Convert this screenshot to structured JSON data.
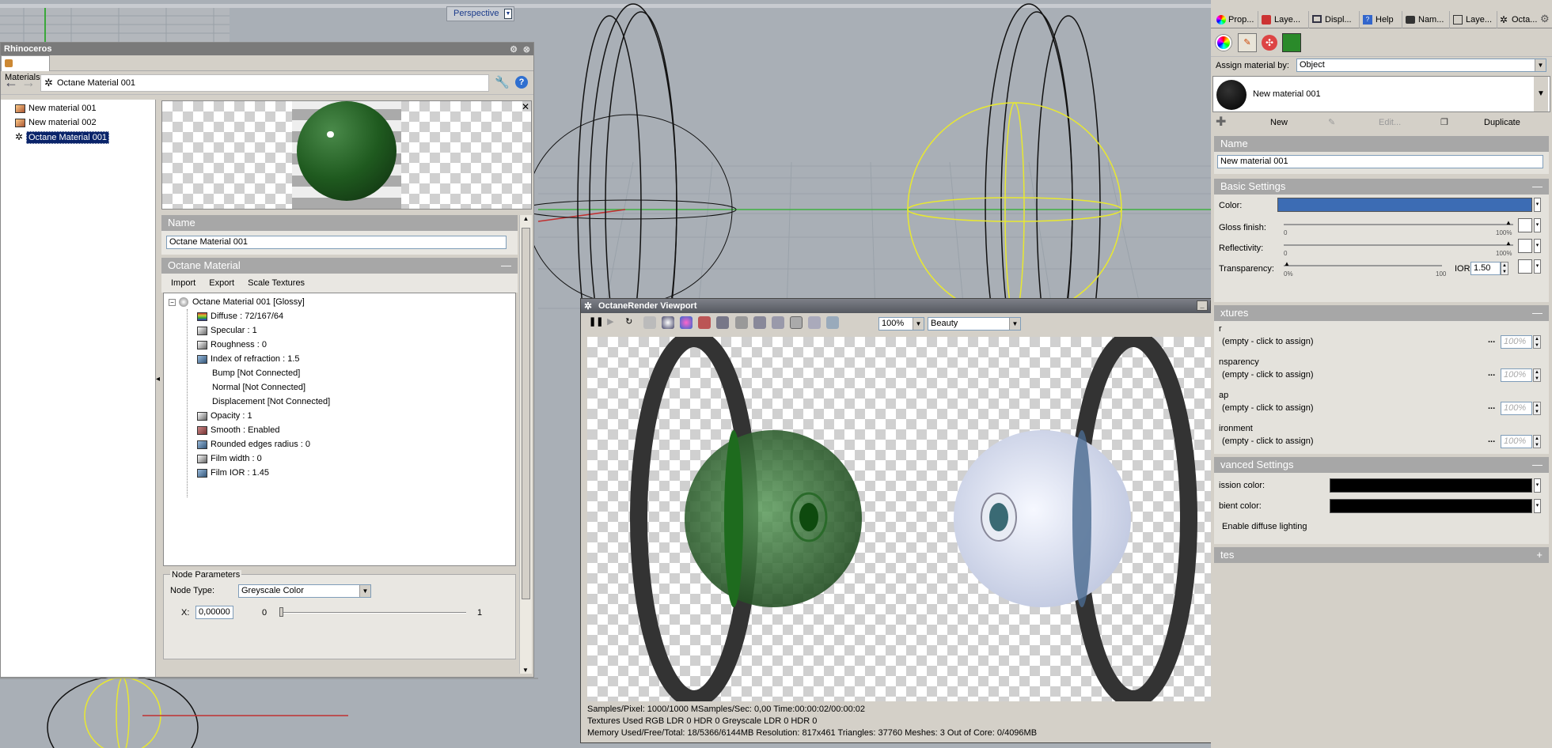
{
  "viewport": {
    "label": "Perspective"
  },
  "materials_window": {
    "app_title": "Rhinoceros",
    "tab": "Materials",
    "current_material": "Octane Material 001",
    "list": [
      "New material 001",
      "New material 002",
      "Octane Material 001"
    ],
    "name_header": "Name",
    "name_value": "Octane Material 001",
    "octane_header": "Octane Material",
    "buttons": [
      "Import",
      "Export",
      "Scale Textures"
    ],
    "tree_root": "Octane Material 001  [Glossy]",
    "tree": [
      "Diffuse : 72/167/64",
      "Specular : 1",
      "Roughness : 0",
      "Index of refraction : 1.5",
      "Bump  [Not Connected]",
      "Normal  [Not Connected]",
      "Displacement  [Not Connected]",
      "Opacity : 1",
      "Smooth : Enabled",
      "Rounded edges radius : 0",
      "Film width : 0",
      "Film IOR : 1.45"
    ],
    "node_params": {
      "title": "Node Parameters",
      "node_type_label": "Node Type:",
      "node_type_value": "Greyscale Color",
      "x_label": "X:",
      "x_value": "0,00000",
      "min": "0",
      "max": "1"
    }
  },
  "octane": {
    "title": "OctaneRender Viewport",
    "zoom": "100%",
    "pass": "Beauty",
    "status1": "Samples/Pixel: 1000/1000  MSamples/Sec: 0,00  Time:00:00:02/00:00:02",
    "status2": "Textures Used RGB LDR 0  HDR 0  Greyscale LDR 0  HDR 0",
    "status3": "Memory Used/Free/Total: 18/5366/6144MB  Resolution: 817x461  Triangles: 37760  Meshes: 3 Out of Core: 0/4096MB"
  },
  "right": {
    "tabs": [
      "Prop...",
      "Laye...",
      "Displ...",
      "Help",
      "Nam...",
      "Laye...",
      "Octa..."
    ],
    "assign_label": "Assign material by:",
    "assign_value": "Object",
    "material": "New material 001",
    "actions": {
      "new": "New",
      "edit": "Edit...",
      "duplicate": "Duplicate"
    },
    "name_header": "Name",
    "name_value": "New material 001",
    "basic_header": "Basic Settings",
    "color_label": "Color:",
    "color": "#3c6cb4",
    "gloss_label": "Gloss finish:",
    "refl_label": "Reflectivity:",
    "trans_label": "Transparency:",
    "ior_label": "IOR:",
    "ior_value": "1.50",
    "scale_0": "0",
    "scale_100p": "100%",
    "scale_0p": "0%",
    "scale_100": "100",
    "textures_header": "xtures",
    "texture_rows": [
      {
        "label": "r",
        "value": "(empty - click to assign)",
        "pct": "100%"
      },
      {
        "label": "nsparency",
        "value": "(empty - click to assign)",
        "pct": "100%"
      },
      {
        "label": "ap",
        "value": "(empty - click to assign)",
        "pct": "100%"
      },
      {
        "label": "ironment",
        "value": "(empty - click to assign)",
        "pct": "100%"
      }
    ],
    "adv_header": "vanced Settings",
    "emission_label": "ission color:",
    "ambient_label": "bient color:",
    "diffuse_lighting": "Enable diffuse lighting",
    "notes_header": "tes"
  }
}
